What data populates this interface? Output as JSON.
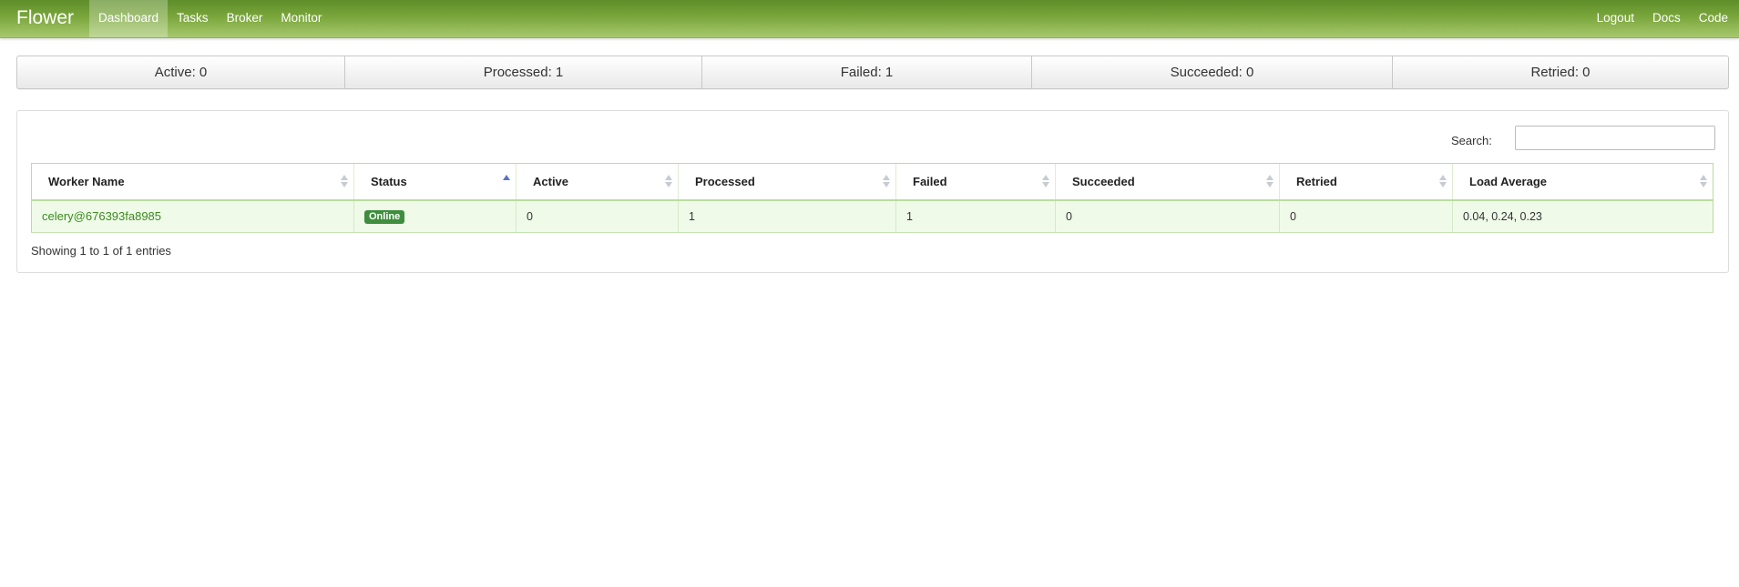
{
  "navbar": {
    "brand": "Flower",
    "left_items": [
      "Dashboard",
      "Tasks",
      "Broker",
      "Monitor"
    ],
    "active_item": "Dashboard",
    "right_items": [
      "Logout",
      "Docs",
      "Code"
    ]
  },
  "summary": {
    "active": "Active: 0",
    "processed": "Processed: 1",
    "failed": "Failed: 1",
    "succeeded": "Succeeded: 0",
    "retried": "Retried: 0"
  },
  "search": {
    "label": "Search:",
    "value": ""
  },
  "table": {
    "columns": [
      "Worker Name",
      "Status",
      "Active",
      "Processed",
      "Failed",
      "Succeeded",
      "Retried",
      "Load Average"
    ],
    "sorted_column": "Status",
    "sort_direction": "ascending",
    "rows": [
      {
        "worker_name": "celery@676393fa8985",
        "status": "Online",
        "active": "0",
        "processed": "1",
        "failed": "1",
        "succeeded": "0",
        "retried": "0",
        "load_average": "0.04, 0.24, 0.23"
      }
    ],
    "info": "Showing 1 to 1 of 1 entries"
  },
  "colors": {
    "navbar_top": "#5e8e2a",
    "navbar_bottom": "#a6c86e",
    "row_background": "#effbe8",
    "link": "#3c8a1e",
    "badge": "#3e8e3e",
    "sort_active": "#5a73c5"
  }
}
